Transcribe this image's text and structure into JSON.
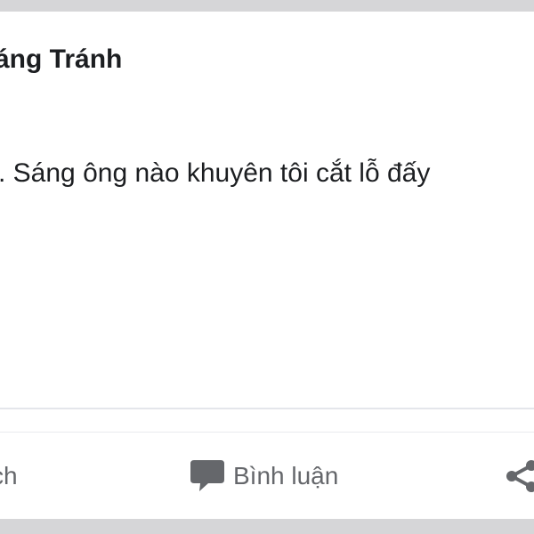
{
  "post": {
    "author_name": "áng Tránh",
    "text": ". Sáng ông nào khuyên tôi cắt lỗ đấy"
  },
  "actions": {
    "like_label": "ch",
    "comment_label": "Bình luận",
    "share_icon": "share-icon",
    "comment_icon": "comment-bubble-icon"
  },
  "colors": {
    "background": "#d6d6d8",
    "card": "#ffffff",
    "text_primary": "#1c1e21",
    "text_secondary": "#65676b"
  }
}
